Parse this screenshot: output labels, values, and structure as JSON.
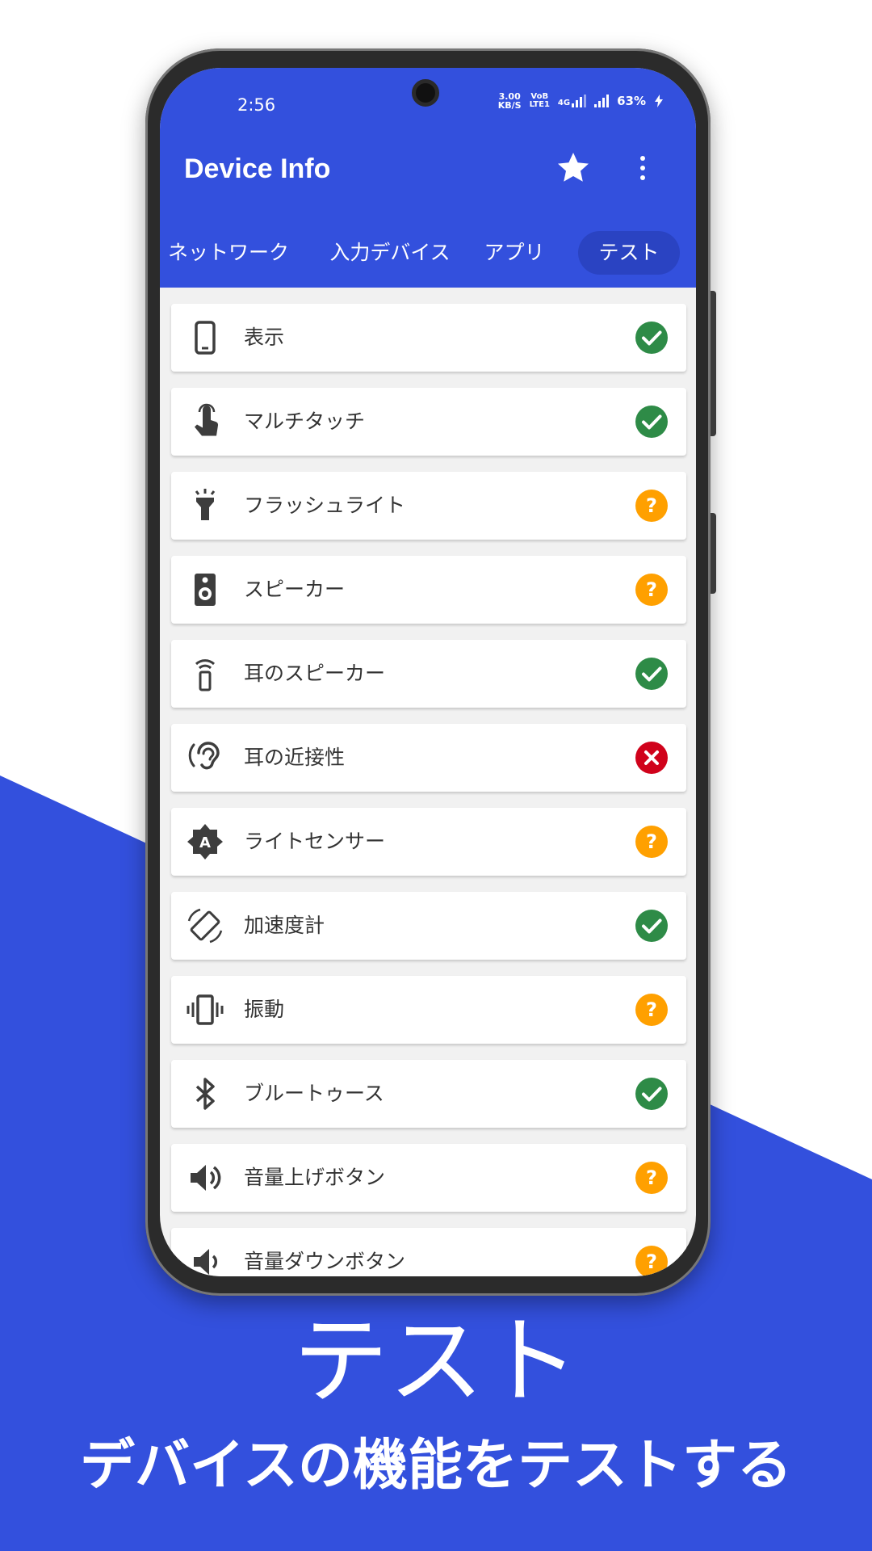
{
  "colors": {
    "brand_blue": "#3350dd",
    "tab_active_bg": "#2a43c2",
    "status_pass": "#2e8b47",
    "status_unknown": "#ffa000",
    "status_fail": "#d0021b"
  },
  "status_bar": {
    "time": "2:56",
    "net_speed_value": "3.00",
    "net_speed_unit": "KB/S",
    "volte_top": "VoB",
    "volte_bottom": "LTE1",
    "net_type": "4G",
    "battery": "63%"
  },
  "app_bar": {
    "title": "Device Info",
    "star_icon": "star-icon",
    "menu_icon": "more-vert-icon"
  },
  "tabs": [
    {
      "label": "ネットワーク",
      "active": false
    },
    {
      "label": "入力デバイス",
      "active": false
    },
    {
      "label": "アプリ",
      "active": false
    },
    {
      "label": "テスト",
      "active": true
    }
  ],
  "tests": [
    {
      "label": "表示",
      "icon": "phone-icon",
      "status": "pass"
    },
    {
      "label": "マルチタッチ",
      "icon": "touch-icon",
      "status": "pass"
    },
    {
      "label": "フラッシュライト",
      "icon": "flashlight-icon",
      "status": "unknown"
    },
    {
      "label": "スピーカー",
      "icon": "speaker-icon",
      "status": "unknown"
    },
    {
      "label": "耳のスピーカー",
      "icon": "ear-speaker-icon",
      "status": "pass"
    },
    {
      "label": "耳の近接性",
      "icon": "ear-icon",
      "status": "fail"
    },
    {
      "label": "ライトセンサー",
      "icon": "brightness-auto-icon",
      "status": "unknown"
    },
    {
      "label": "加速度計",
      "icon": "screen-rotation-icon",
      "status": "pass"
    },
    {
      "label": "振動",
      "icon": "vibration-icon",
      "status": "unknown"
    },
    {
      "label": "ブルートゥース",
      "icon": "bluetooth-icon",
      "status": "pass"
    },
    {
      "label": "音量上げボタン",
      "icon": "volume-up-icon",
      "status": "unknown"
    },
    {
      "label": "音量ダウンボタン",
      "icon": "volume-down-icon",
      "status": "unknown"
    }
  ],
  "caption": {
    "title": "テスト",
    "subtitle": "デバイスの機能をテストする"
  }
}
